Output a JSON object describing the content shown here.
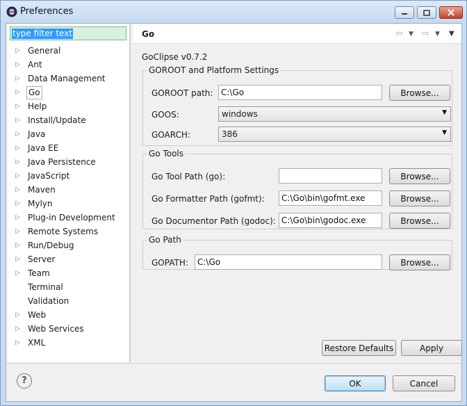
{
  "window": {
    "title": "Preferences"
  },
  "filter": {
    "value": "type filter text"
  },
  "tree": [
    {
      "label": "General",
      "expandable": true
    },
    {
      "label": "Ant",
      "expandable": true
    },
    {
      "label": "Data Management",
      "expandable": true
    },
    {
      "label": "Go",
      "expandable": true,
      "selected": true
    },
    {
      "label": "Help",
      "expandable": true
    },
    {
      "label": "Install/Update",
      "expandable": true
    },
    {
      "label": "Java",
      "expandable": true
    },
    {
      "label": "Java EE",
      "expandable": true
    },
    {
      "label": "Java Persistence",
      "expandable": true
    },
    {
      "label": "JavaScript",
      "expandable": true
    },
    {
      "label": "Maven",
      "expandable": true
    },
    {
      "label": "Mylyn",
      "expandable": true
    },
    {
      "label": "Plug-in Development",
      "expandable": true
    },
    {
      "label": "Remote Systems",
      "expandable": true
    },
    {
      "label": "Run/Debug",
      "expandable": true
    },
    {
      "label": "Server",
      "expandable": true
    },
    {
      "label": "Team",
      "expandable": true
    },
    {
      "label": "Terminal",
      "expandable": false
    },
    {
      "label": "Validation",
      "expandable": false
    },
    {
      "label": "Web",
      "expandable": true
    },
    {
      "label": "Web Services",
      "expandable": true
    },
    {
      "label": "XML",
      "expandable": true
    }
  ],
  "page": {
    "title": "Go",
    "version": "GoClipse v0.7.2"
  },
  "goroot_group": {
    "title": "GOROOT and Platform Settings",
    "goroot_label": "GOROOT path:",
    "goroot_value": "C:\\Go",
    "goos_label": "GOOS:",
    "goos_value": "windows",
    "goarch_label": "GOARCH:",
    "goarch_value": "386"
  },
  "tools_group": {
    "title": "Go Tools",
    "tool_label": "Go Tool Path (go):",
    "tool_value": "",
    "fmt_label": "Go Formatter Path (gofmt):",
    "fmt_value": "C:\\Go\\bin\\gofmt.exe",
    "doc_label": "Go Documentor Path (godoc):",
    "doc_value": "C:\\Go\\bin\\godoc.exe"
  },
  "gopath_group": {
    "title": "Go Path",
    "gopath_label": "GOPATH:",
    "gopath_value": "C:\\Go"
  },
  "buttons": {
    "browse": "Browse...",
    "restore": "Restore Defaults",
    "apply": "Apply",
    "ok": "OK",
    "cancel": "Cancel"
  },
  "icons": {
    "help": "?"
  }
}
